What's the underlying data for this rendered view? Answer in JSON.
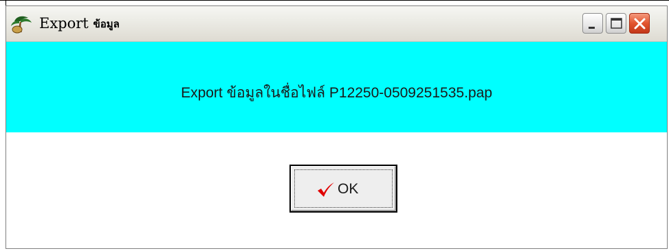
{
  "window": {
    "title_prefix": "Export",
    "title_thai": "ข้อมูล",
    "icon": "palm-tree-app-icon",
    "controls": {
      "minimize": "minimize-icon",
      "maximize": "maximize-icon",
      "close": "close-icon"
    }
  },
  "banner": {
    "message": "Export ข้อมูลในชื่อไฟล์ P12250-0509251535.pap",
    "color": "#00ffff"
  },
  "ok_button": {
    "label": "OK",
    "icon": "checkmark-icon",
    "icon_color": "#e00000"
  }
}
